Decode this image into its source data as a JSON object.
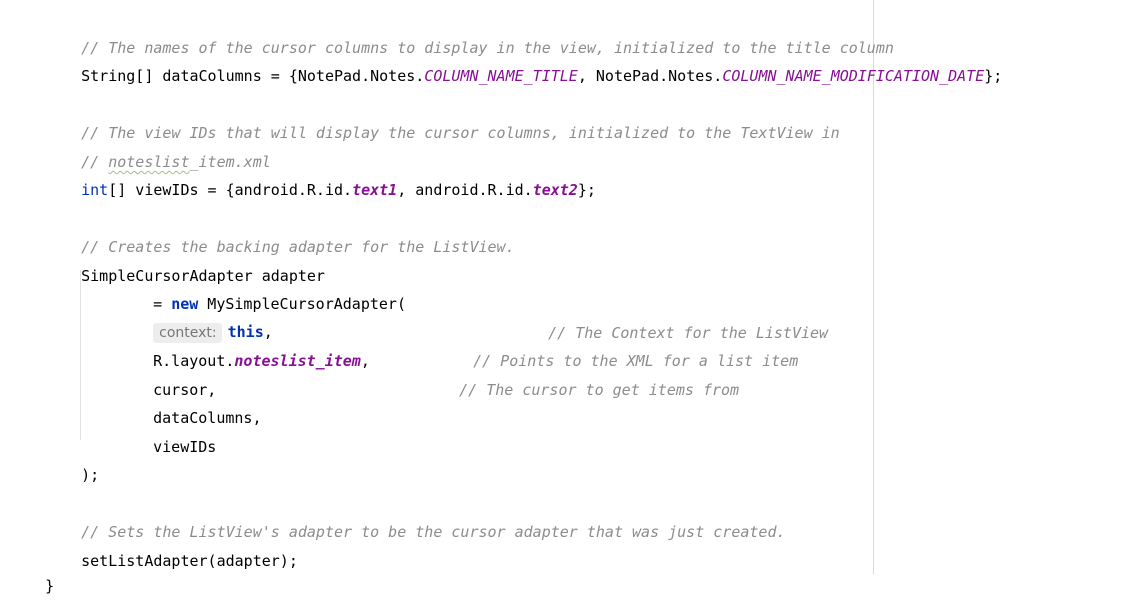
{
  "editor": {
    "comment_column_names": "// The names of the cursor columns to display in the view, initialized to the title column",
    "data_columns": {
      "decl": "String[] dataColumns = {NotePad.Notes.",
      "field1": "COLUMN_NAME_TITLE",
      "mid": ", NotePad.Notes.",
      "field2": "COLUMN_NAME_MODIFICATION_DATE",
      "end": "};"
    },
    "comment_view_ids_1": "// The view IDs that will display the cursor columns, initialized to the TextView in",
    "comment_view_ids_2_prefix": "// ",
    "comment_view_ids_2_word": "noteslist",
    "comment_view_ids_2_suffix": "_item.xml",
    "view_ids": {
      "keyword": "int",
      "decl": "[] viewIDs = {android.R.id.",
      "field1": "text1",
      "mid": ", android.R.id.",
      "field2": "text2",
      "end": "};"
    },
    "comment_adapter": "// Creates the backing adapter for the ListView.",
    "adapter_decl": "SimpleCursorAdapter adapter",
    "adapter_new": {
      "prefix": "= ",
      "keyword": "new",
      "suffix": " MySimpleCursorAdapter("
    },
    "arg_context": {
      "hint": "context:",
      "keyword": "this",
      "comma": ",",
      "comment": "// The Context for the ListView"
    },
    "arg_layout": {
      "prefix": "R.layout.",
      "field": "noteslist_item",
      "comma": ",",
      "comment": "// Points to the XML for a list item"
    },
    "arg_cursor": {
      "code": "cursor,",
      "comment": "// The cursor to get items from"
    },
    "arg_data_columns": "dataColumns,",
    "arg_view_ids": "viewIDs",
    "close_paren": ");",
    "comment_set_adapter": "// Sets the ListView's adapter to be the cursor adapter that was just created.",
    "set_list_adapter": "setListAdapter(adapter);",
    "closing_brace": "}"
  }
}
